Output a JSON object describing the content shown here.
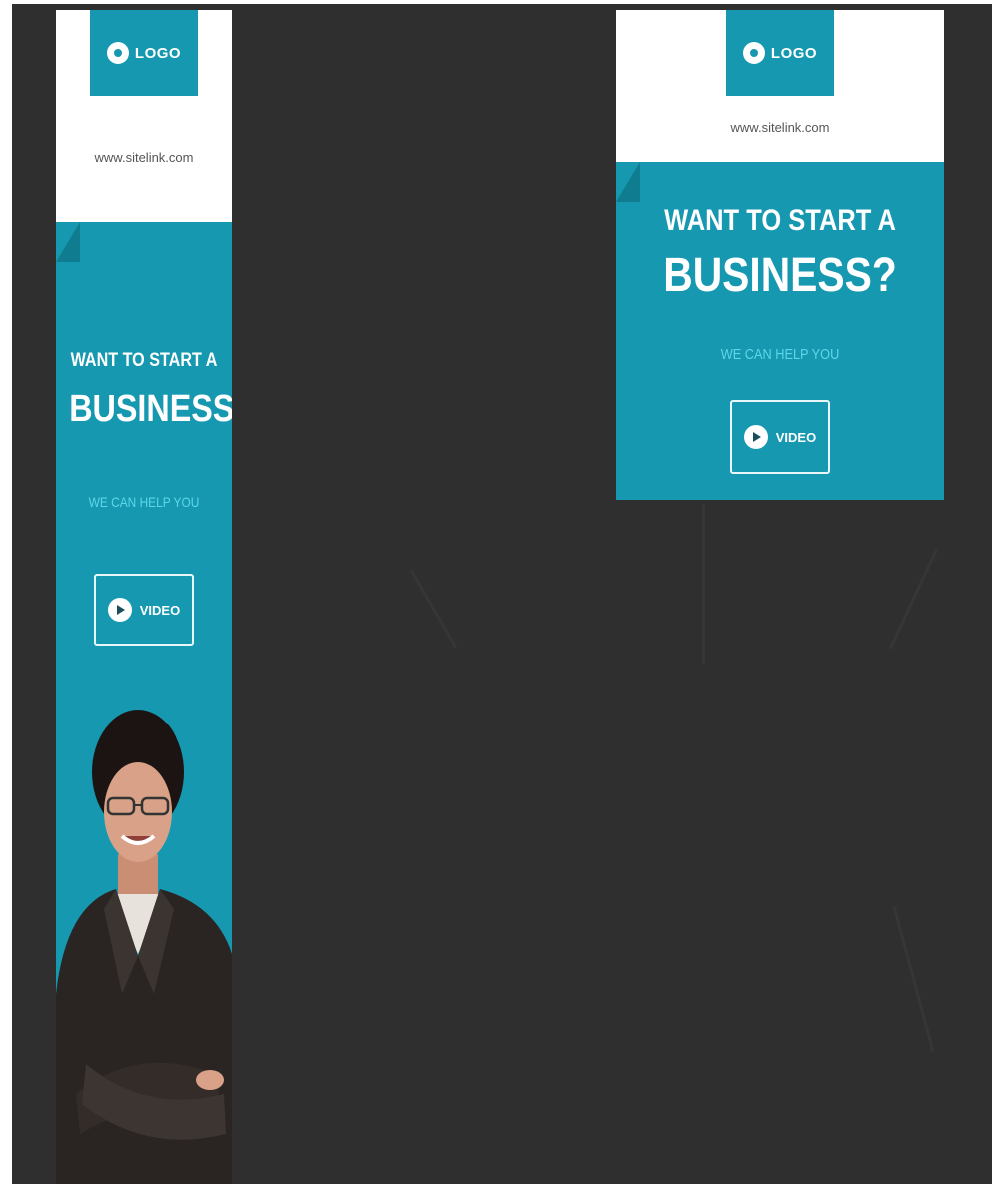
{
  "colors": {
    "teal": "#1598b0",
    "background": "#2f2f2f",
    "tagline": "#5fd6ea"
  },
  "skyscraper": {
    "logo_text": "LOGO",
    "site_url": "www.sitelink.com",
    "headline_line1": "WANT TO START A",
    "headline_line2": "BUSINESS?",
    "tagline": "WE CAN HELP YOU",
    "video_label": "VIDEO"
  },
  "rectangle": {
    "logo_text": "LOGO",
    "site_url": "www.sitelink.com",
    "headline_line1": "WANT TO START A",
    "headline_line2": "BUSINESS?",
    "tagline": "WE CAN HELP YOU",
    "video_label": "VIDEO"
  }
}
